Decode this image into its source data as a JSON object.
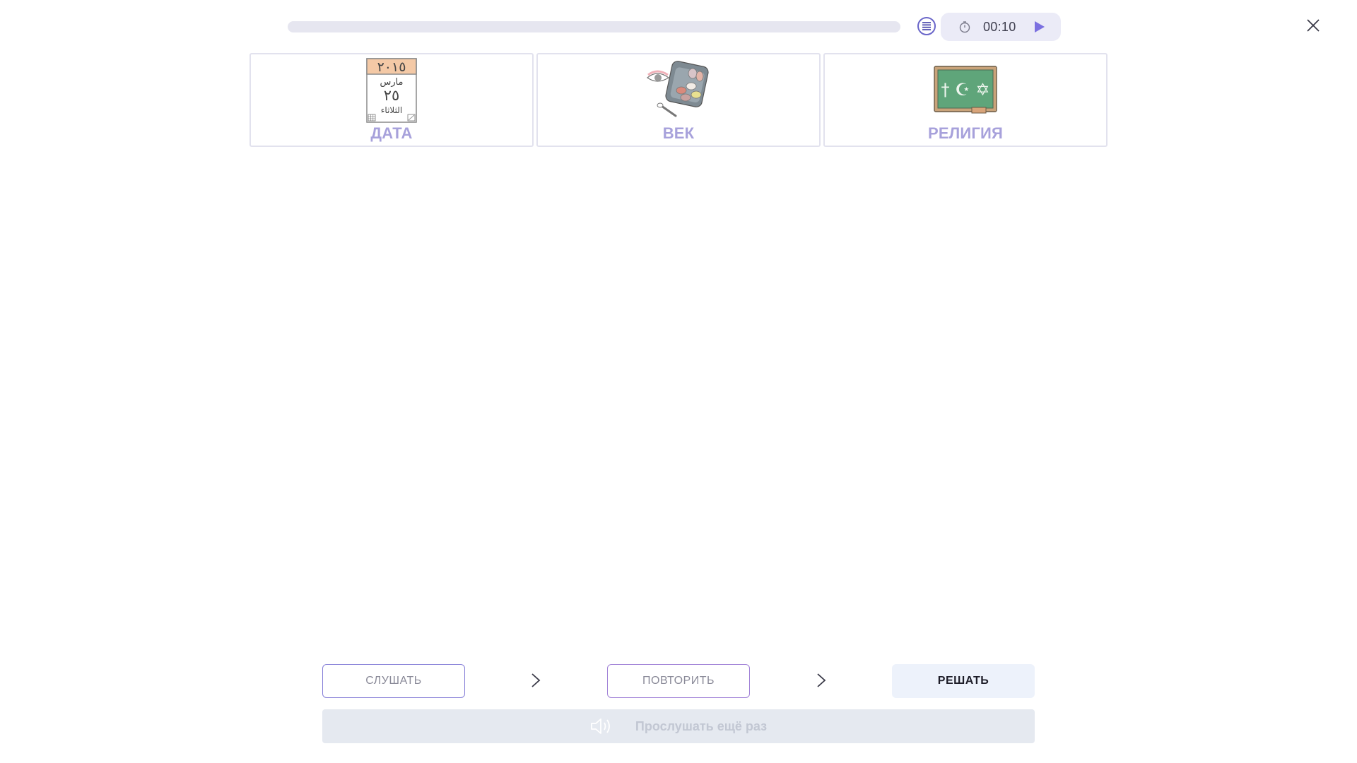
{
  "header": {
    "progress_fraction": 0.0,
    "timer": "00:10",
    "colors": {
      "accent": "#6a66c9",
      "progress_track": "#e6e6f0",
      "timer_bg": "#ebebf7"
    }
  },
  "cards": [
    {
      "label": "ДАТА",
      "icon": "calendar-page-icon",
      "calendar": {
        "year": "٢٠١٥",
        "month": "مارس",
        "day": "٢٥",
        "weekday": "الثلاثاء"
      }
    },
    {
      "label": "ВЕК",
      "icon": "eyeshadow-palette-icon"
    },
    {
      "label": "РЕЛИГИЯ",
      "icon": "religion-chalkboard-icon",
      "symbols": "† ☪ ✡"
    }
  ],
  "steps": {
    "listen": "СЛУШАТЬ",
    "repeat": "ПОВТОРИТЬ",
    "solve": "РЕШАТЬ"
  },
  "replay": {
    "label": "Прослушать ещё раз"
  },
  "colors": {
    "card_label": "#a7a1db",
    "card_border": "#e2e2ee",
    "solve_bg": "#edf2fb",
    "replay_bg": "#e5e9f0"
  }
}
